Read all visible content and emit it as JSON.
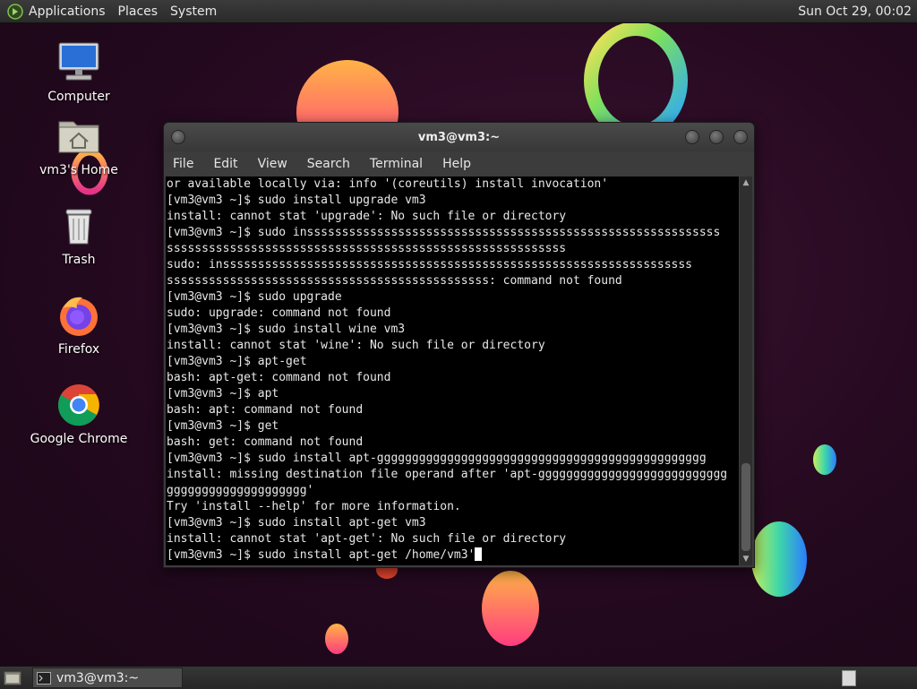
{
  "top_panel": {
    "menus": [
      "Applications",
      "Places",
      "System"
    ],
    "clock": "Sun Oct 29, 00:02"
  },
  "desktop": {
    "icons": [
      {
        "label": "Computer",
        "icon": "computer-icon"
      },
      {
        "label": "vm3's Home",
        "icon": "home-folder-icon"
      },
      {
        "label": "Trash",
        "icon": "trash-icon"
      },
      {
        "label": "Firefox",
        "icon": "firefox-icon"
      },
      {
        "label": "Google Chrome",
        "icon": "chrome-icon"
      }
    ]
  },
  "terminal": {
    "title": "vm3@vm3:~",
    "menu": [
      "File",
      "Edit",
      "View",
      "Search",
      "Terminal",
      "Help"
    ],
    "lines": [
      "or available locally via: info '(coreutils) install invocation'",
      "[vm3@vm3 ~]$ sudo install upgrade vm3",
      "install: cannot stat 'upgrade': No such file or directory",
      "[vm3@vm3 ~]$ sudo insssssssssssssssssssssssssssssssssssssssssssssssssssssssssss",
      "sssssssssssssssssssssssssssssssssssssssssssssssssssssssss",
      "sudo: insssssssssssssssssssssssssssssssssssssssssssssssssssssssssssssssssss",
      "ssssssssssssssssssssssssssssssssssssssssssssss: command not found",
      "[vm3@vm3 ~]$ sudo upgrade",
      "sudo: upgrade: command not found",
      "[vm3@vm3 ~]$ sudo install wine vm3",
      "install: cannot stat 'wine': No such file or directory",
      "[vm3@vm3 ~]$ apt-get",
      "bash: apt-get: command not found",
      "[vm3@vm3 ~]$ apt",
      "bash: apt: command not found",
      "[vm3@vm3 ~]$ get",
      "bash: get: command not found",
      "[vm3@vm3 ~]$ sudo install apt-ggggggggggggggggggggggggggggggggggggggggggggggg",
      "install: missing destination file operand after 'apt-ggggggggggggggggggggggggggg",
      "gggggggggggggggggggg'",
      "Try 'install --help' for more information.",
      "[vm3@vm3 ~]$ sudo install apt-get vm3",
      "install: cannot stat 'apt-get': No such file or directory",
      "[vm3@vm3 ~]$ sudo install apt-get /home/vm3'"
    ]
  },
  "taskbar": {
    "task_label": "vm3@vm3:~"
  }
}
